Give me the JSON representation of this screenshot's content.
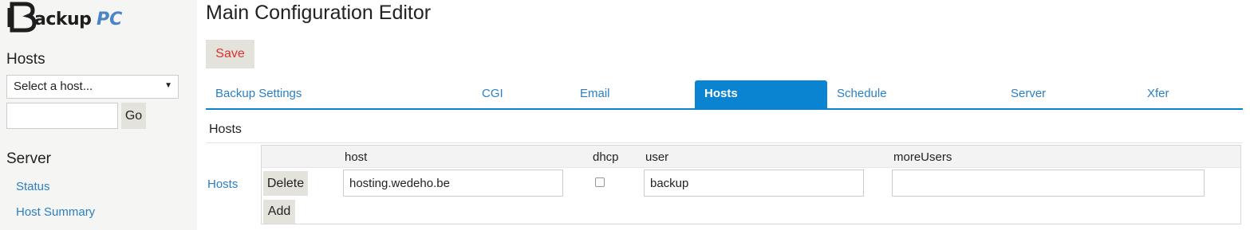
{
  "logo": {
    "main": "ackup",
    "pc": "PC"
  },
  "sidebar": {
    "hosts_heading": "Hosts",
    "host_select": "Select a host...",
    "host_input_value": "",
    "go_label": "Go",
    "server_heading": "Server",
    "links": [
      {
        "label": "Status"
      },
      {
        "label": "Host Summary"
      }
    ]
  },
  "main": {
    "title": "Main Configuration Editor",
    "save_label": "Save",
    "tabs": [
      {
        "label": "Backup Settings"
      },
      {
        "label": "CGI"
      },
      {
        "label": "Email"
      },
      {
        "label": "Hosts"
      },
      {
        "label": "Schedule"
      },
      {
        "label": "Server"
      },
      {
        "label": "Xfer"
      }
    ],
    "active_tab": "Hosts",
    "section_label": "Hosts",
    "field_label": "Hosts",
    "table": {
      "columns": [
        "host",
        "dhcp",
        "user",
        "moreUsers"
      ],
      "rows": [
        {
          "host": "hosting.wedeho.be",
          "dhcp": false,
          "user": "backup",
          "moreUsers": ""
        }
      ],
      "delete_label": "Delete",
      "add_label": "Add"
    }
  },
  "colors": {
    "accent": "#0a84d0",
    "link": "#2a7fc4",
    "save_text": "#e03030",
    "sidebar_bg": "#f5f5f3",
    "button_bg": "#e3e3dc"
  }
}
